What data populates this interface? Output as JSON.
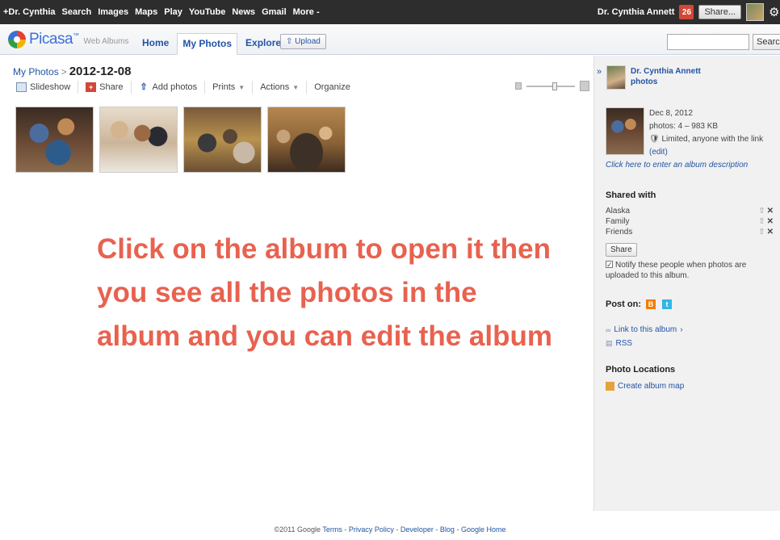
{
  "gbar": {
    "links": [
      "+Dr. Cynthia",
      "Search",
      "Images",
      "Maps",
      "Play",
      "YouTube",
      "News",
      "Gmail",
      "More -"
    ],
    "user_name": "Dr. Cynthia Annett",
    "notification_count": "26",
    "share_label": "Share..."
  },
  "header": {
    "logo_text": "Picasa",
    "logo_tm": "™",
    "logo_sub": "Web Albums",
    "tabs": [
      "Home",
      "My Photos",
      "Explore"
    ],
    "active_tab": "My Photos",
    "upload_label": "Upload",
    "search_placeholder": "",
    "search_button": "Search"
  },
  "breadcrumb": {
    "parent": "My Photos",
    "separator": ">",
    "album_title": "2012-12-08"
  },
  "toolbar": {
    "slideshow": "Slideshow",
    "share": "Share",
    "add_photos": "Add photos",
    "prints": "Prints",
    "actions": "Actions",
    "organize": "Organize"
  },
  "thumbnails": [
    {
      "name": "photo-1"
    },
    {
      "name": "photo-2"
    },
    {
      "name": "photo-3"
    },
    {
      "name": "photo-4"
    }
  ],
  "instruction": {
    "line1": "Click on the album to open it then",
    "line2": "you see all the photos in the",
    "line3": "album and you can edit the album"
  },
  "panel": {
    "collapse_glyph": "»",
    "owner_name_line1": "Dr. Cynthia Annett",
    "owner_name_line2": "photos",
    "album_date": "Dec 8, 2012",
    "album_stats": "photos: 4 – 983 KB",
    "visibility": "Limited, anyone with the link",
    "visibility_edit": "(edit)",
    "description_prompt": "Click here to enter an album description",
    "shared_with_heading": "Shared with",
    "shared_with": [
      "Alaska",
      "Family",
      "Friends"
    ],
    "share_button": "Share",
    "notify_text": "Notify these people when photos are uploaded to this album.",
    "post_on_label": "Post on:",
    "link_to_album": "Link to this album",
    "rss": "RSS",
    "photo_locations_heading": "Photo Locations",
    "create_album_map": "Create album map"
  },
  "footer": {
    "copyright": "©2011 Google",
    "links": [
      "Terms",
      "Privacy Policy",
      "Developer",
      "Blog",
      "Google Home"
    ]
  },
  "colors": {
    "instruction_text": "#e8624f",
    "link_blue": "#2254a3",
    "gbar_bg": "#2d2d2d",
    "notification_red": "#d14836"
  }
}
